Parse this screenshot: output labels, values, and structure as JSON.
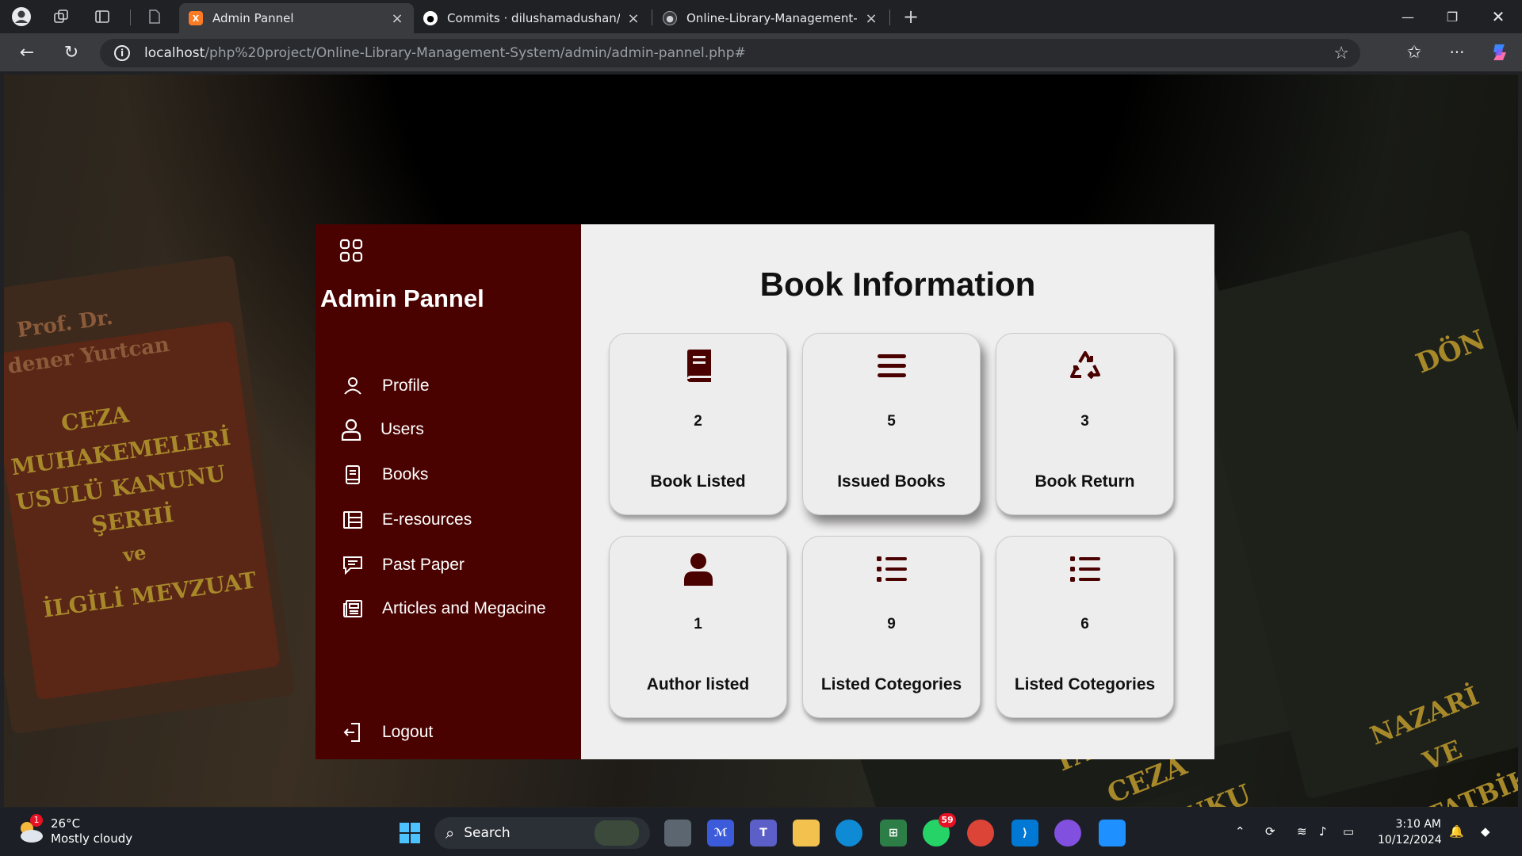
{
  "browser": {
    "tabs": [
      {
        "title": "Admin Pannel",
        "active": true
      },
      {
        "title": "Commits · dilushamadushan/Onli",
        "active": false
      },
      {
        "title": "Online-Library-Management-Syst",
        "active": false
      }
    ],
    "url_host": "localhost",
    "url_path": "/php%20project/Online-Library-Management-System/admin/admin-pannel.php#"
  },
  "sidebar": {
    "brand": "Admin Pannel",
    "items": [
      {
        "label": "Profile",
        "icon": "user-icon"
      },
      {
        "label": "Users",
        "icon": "users-icon"
      },
      {
        "label": "Books",
        "icon": "book-icon"
      },
      {
        "label": "E-resources",
        "icon": "table-icon"
      },
      {
        "label": "Past Paper",
        "icon": "message-icon"
      },
      {
        "label": "Articles and Megacine",
        "icon": "newspaper-icon"
      }
    ],
    "logout": "Logout"
  },
  "main": {
    "title": "Book Information",
    "cards": [
      {
        "count": "2",
        "label": "Book Listed",
        "icon": "book-icon"
      },
      {
        "count": "5",
        "label": "Issued Books",
        "icon": "menu-icon"
      },
      {
        "count": "3",
        "label": "Book Return",
        "icon": "recycle-icon"
      },
      {
        "count": "1",
        "label": "Author listed",
        "icon": "user-icon"
      },
      {
        "count": "9",
        "label": "Listed Categories",
        "label_text": "Listed Cotegories",
        "icon": "list-icon"
      },
      {
        "count": "6",
        "label": "Listed Categories",
        "label_text": "Listed Cotegories",
        "icon": "list-icon"
      }
    ]
  },
  "background_spine_text": [
    "Prof. Dr.",
    "dener Yurtcan",
    "CEZA",
    "MUHAKEMELERİ",
    "USULÜ KANUNU",
    "ŞERHİ",
    "ve",
    "İLGİLİ MEVZUAT",
    "TATBİKİ",
    "CEZA",
    "HUKUKU",
    "NAZARİ",
    "VE",
    "TATBİKİ",
    "DÖN"
  ],
  "taskbar": {
    "weather_temp": "26°C",
    "weather_desc": "Mostly cloudy",
    "weather_badge": "1",
    "search_label": "Search",
    "whatsapp_badge": "59",
    "time": "3:10 AM",
    "date": "10/12/2024"
  },
  "colors": {
    "sidebar": "#4a0200",
    "content_bg": "#f0efef",
    "icon": "#4a0200"
  }
}
